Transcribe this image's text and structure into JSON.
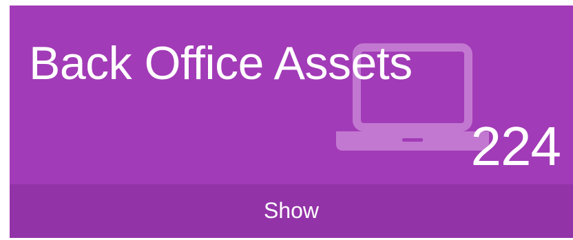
{
  "tile": {
    "title": "Back Office Assets",
    "count": "224",
    "icon": "laptop-icon",
    "footer_label": "Show",
    "colors": {
      "background": "#a23bb7",
      "footer_background": "#9333a8",
      "text": "#ffffff",
      "icon": "#c57fd4"
    }
  }
}
